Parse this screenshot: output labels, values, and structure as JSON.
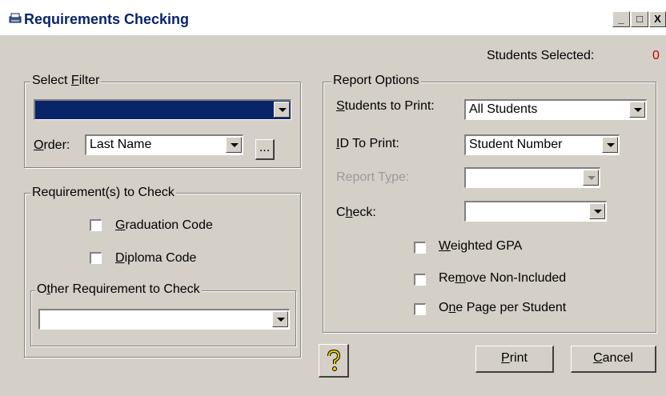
{
  "window": {
    "title": "Requirements Checking",
    "controls": [
      "_",
      "□",
      "X"
    ]
  },
  "status": {
    "students_selected_label": "Students Selected:",
    "students_selected_value": "0",
    "value_color": "#c00000"
  },
  "select_filter": {
    "legend": "Select Filter",
    "filter_value": "",
    "order_label": "Order:",
    "order_value": "Last Name",
    "ellipsis_label": "..."
  },
  "requirements": {
    "legend": "Requirement(s) to Check",
    "graduation_code": "Graduation Code",
    "diploma_code": "Diploma Code",
    "other_legend": "Other Requirement to Check",
    "other_value": ""
  },
  "report_options": {
    "legend": "Report Options",
    "students_to_print_label": "Students to Print:",
    "students_to_print_value": "All Students",
    "id_to_print_label": "ID To Print:",
    "id_to_print_value": "Student Number",
    "report_type_label": "Report Type:",
    "report_type_value": "",
    "check_label": "Check:",
    "check_value": "",
    "weighted_gpa": "Weighted GPA",
    "remove_non_included": "Remove Non-Included",
    "one_page_per_student": "One Page per Student"
  },
  "buttons": {
    "help_icon": "help-question-icon",
    "print": "Print",
    "cancel": "Cancel"
  },
  "colors": {
    "face": "#d4d0c8",
    "selection": "#0a246a"
  }
}
